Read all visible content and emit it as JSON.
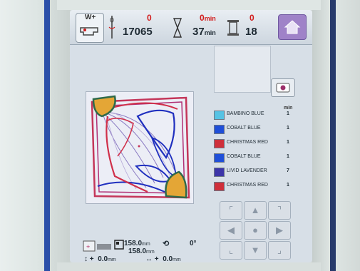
{
  "status": {
    "pattern_label": "W+",
    "stitch_zero": "0",
    "stitch_count": "17065",
    "time_zero": "0",
    "time_total": "37",
    "time_unit": "min",
    "color_zero": "0",
    "color_total": "18"
  },
  "threads": {
    "header": "min",
    "items": [
      {
        "name": "BAMBINO BLUE",
        "count": "1",
        "color": "#57c3e4"
      },
      {
        "name": "COBALT BLUE",
        "count": "1",
        "color": "#1f4fd8"
      },
      {
        "name": "CHRISTMAS RED",
        "count": "1",
        "color": "#cf2f3a"
      },
      {
        "name": "COBALT BLUE",
        "count": "1",
        "color": "#1f4fd8"
      },
      {
        "name": "LIVID LAVENDER",
        "count": "7",
        "color": "#3c35a8"
      },
      {
        "name": "CHRISTMAS RED",
        "count": "1",
        "color": "#cf2f3a"
      }
    ]
  },
  "bottom": {
    "width": "158.0",
    "height": "158.0",
    "size_unit": "mm",
    "angle": "0°",
    "offset_y": "0.0",
    "offset_x": "0.0",
    "offset_unit": "mm"
  },
  "icons": {
    "needle": "needle-icon",
    "hourglass": "hourglass-icon",
    "spool": "spool-icon",
    "home": "home-icon",
    "camera": "camera-icon"
  }
}
